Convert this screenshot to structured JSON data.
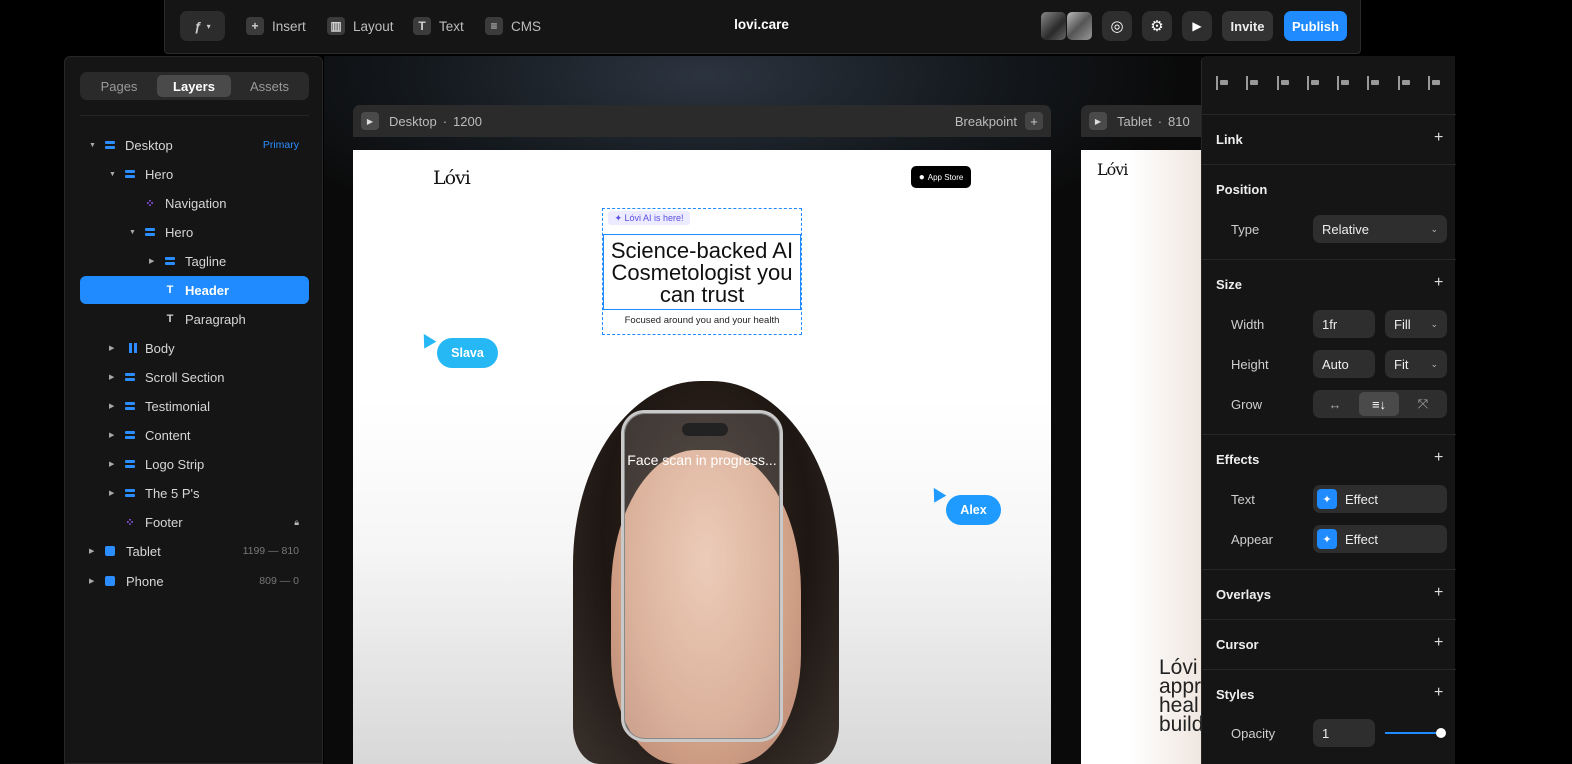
{
  "toolbar": {
    "insert": "Insert",
    "layout": "Layout",
    "text": "Text",
    "cms": "CMS",
    "site_title": "lovi.care",
    "invite": "Invite",
    "publish": "Publish"
  },
  "left_panel": {
    "tabs": [
      "Pages",
      "Layers",
      "Assets"
    ],
    "active_tab": "Layers",
    "layers": [
      {
        "name": "Desktop",
        "meta": "Primary"
      },
      {
        "name": "Hero"
      },
      {
        "name": "Navigation"
      },
      {
        "name": "Hero"
      },
      {
        "name": "Tagline"
      },
      {
        "name": "Header"
      },
      {
        "name": "Paragraph"
      },
      {
        "name": "Body"
      },
      {
        "name": "Scroll Section"
      },
      {
        "name": "Testimonial"
      },
      {
        "name": "Content"
      },
      {
        "name": "Logo Strip"
      },
      {
        "name": "The 5 P's"
      },
      {
        "name": "Footer"
      },
      {
        "name": "Tablet",
        "meta": "1199 — 810"
      },
      {
        "name": "Phone",
        "meta": "809 — 0"
      }
    ]
  },
  "canvas": {
    "desktop": {
      "label": "Desktop",
      "width": "1200",
      "breakpoint": "Breakpoint"
    },
    "tablet": {
      "label": "Tablet",
      "width": "810"
    },
    "brand": "Lóvi",
    "app_store": "App Store",
    "tagline": "✦ Lóvi AI is here!",
    "headline": "Science-backed AI Cosmetologist you can trust",
    "paragraph": "Focused around you and your health",
    "scan_text": "Face scan in progress...",
    "cursor_slava": "Slava",
    "cursor_alex": "Alex",
    "tablet_text": "Lóvi appr heal build"
  },
  "right_panel": {
    "link": "Link",
    "position": "Position",
    "type_label": "Type",
    "type_value": "Relative",
    "size": "Size",
    "width_label": "Width",
    "width_value": "1fr",
    "width_mode": "Fill",
    "height_label": "Height",
    "height_value": "Auto",
    "height_mode": "Fit",
    "grow_label": "Grow",
    "effects": "Effects",
    "text_label": "Text",
    "text_effect": "Effect",
    "appear_label": "Appear",
    "appear_effect": "Effect",
    "overlays": "Overlays",
    "cursor": "Cursor",
    "styles": "Styles",
    "opacity_label": "Opacity",
    "opacity_value": "1"
  },
  "colors": {
    "accent": "#1f8bff",
    "cursor_slava": "#26b8f5",
    "cursor_alex": "#1f9bff"
  }
}
